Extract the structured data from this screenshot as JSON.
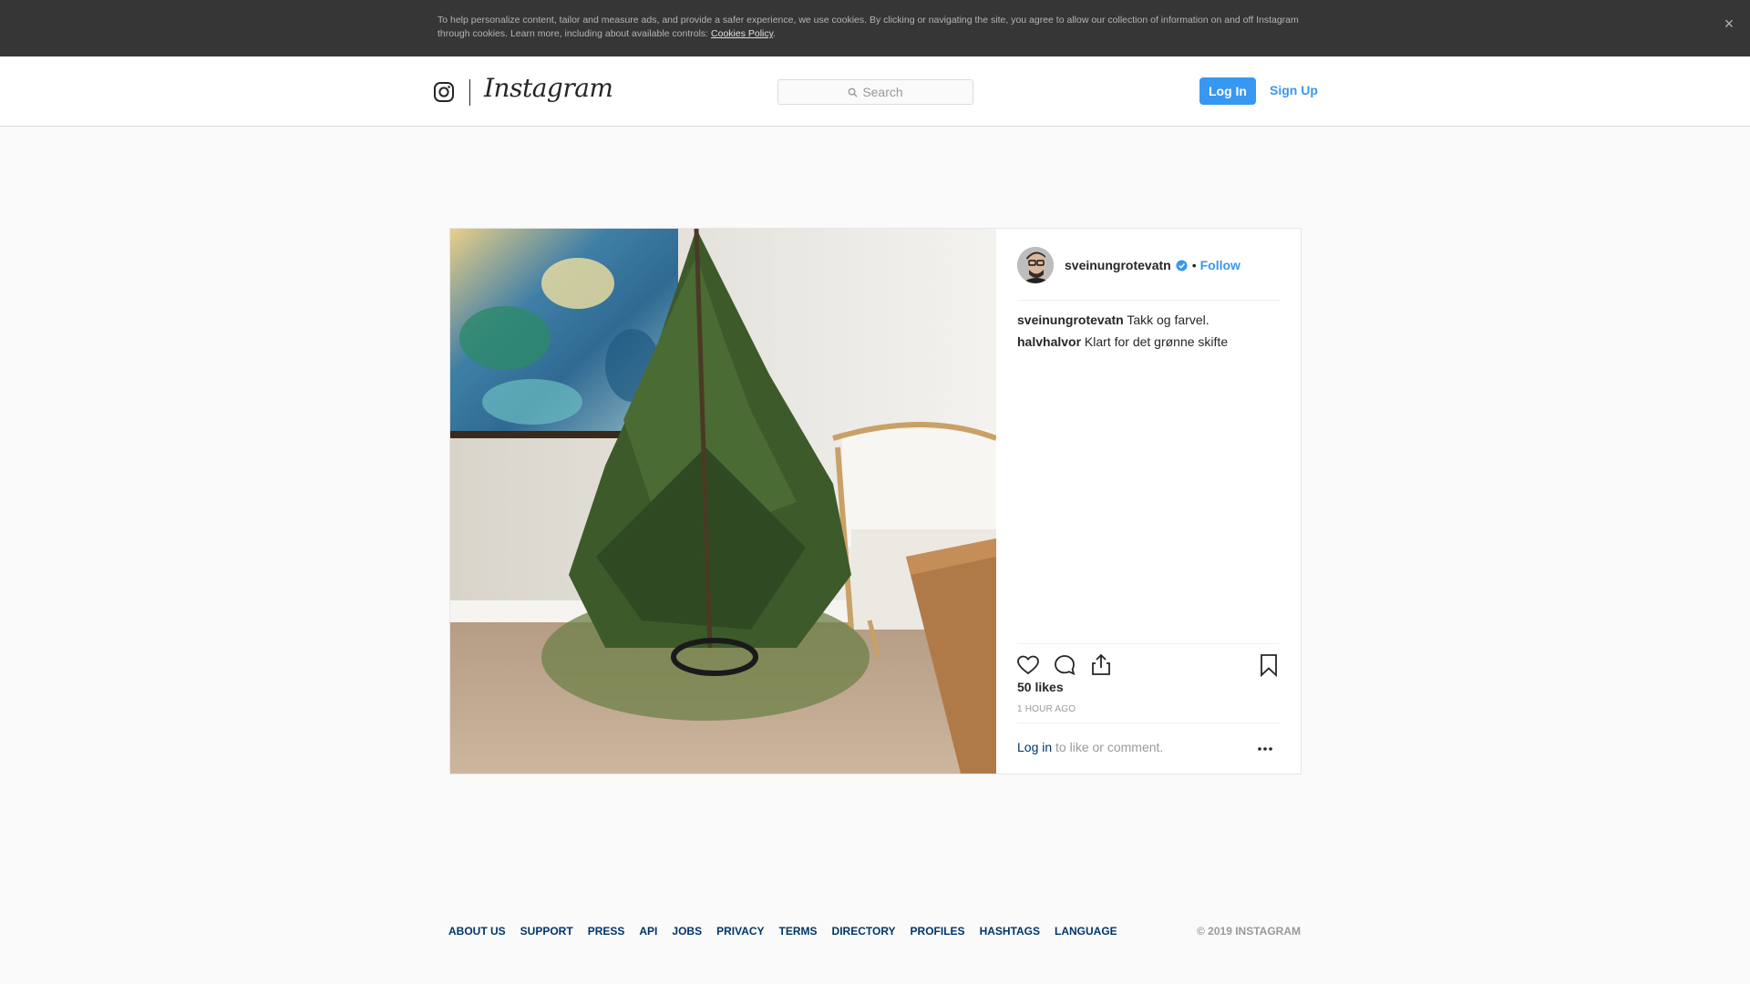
{
  "cookie_banner": {
    "text": "To help personalize content, tailor and measure ads, and provide a safer experience, we use cookies. By clicking or navigating the site, you agree to allow our collection of information on and off Instagram through cookies. Learn more, including about available controls: ",
    "link": "Cookies Policy",
    "period": ".",
    "close_icon": "×"
  },
  "header": {
    "logo_icon": "instagram-camera-icon",
    "wordmark": "Instagram",
    "search_placeholder": "Search",
    "login_label": "Log In",
    "signup_label": "Sign Up"
  },
  "post": {
    "author": "sveinungrotevatn",
    "verified": true,
    "dot": "•",
    "follow_label": "Follow",
    "comments": [
      {
        "user": "sveinungrotevatn",
        "text": " Takk og farvel."
      },
      {
        "user": "halvhalvor",
        "text": " Klart for det grønne skifte"
      }
    ],
    "likes": "50 likes",
    "timestamp": "1 HOUR AGO",
    "login_link": "Log in",
    "login_suffix": " to like or comment.",
    "icons": [
      "heart-icon",
      "comment-icon",
      "share-icon",
      "bookmark-icon",
      "more-options-icon"
    ]
  },
  "footer": {
    "links": [
      "About us",
      "Support",
      "Press",
      "API",
      "Jobs",
      "Privacy",
      "Terms",
      "Directory",
      "Profiles",
      "Hashtags",
      "Language"
    ],
    "copyright": "© 2019 Instagram"
  },
  "colors": {
    "accent": "#3897f0",
    "link_dark": "#003569",
    "banner_bg": "#363636"
  }
}
